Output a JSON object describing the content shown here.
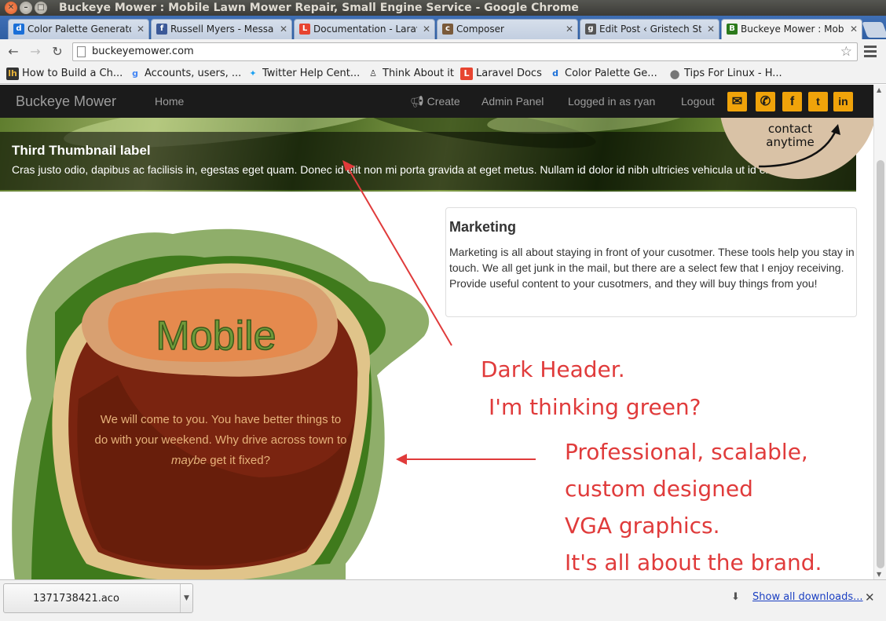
{
  "window": {
    "title": "Buckeye Mower : Mobile Lawn Mower Repair, Small Engine Service - Google Chrome"
  },
  "tabs": [
    {
      "label": "Color Palette Generato",
      "icon": "d-logo-icon",
      "color": "#1a6fd8"
    },
    {
      "label": "Russell Myers - Message",
      "icon": "facebook-icon",
      "color": "#3b5998"
    },
    {
      "label": "Documentation - Larave",
      "icon": "laravel-icon",
      "color": "#e74430"
    },
    {
      "label": "Composer",
      "icon": "composer-icon",
      "color": "#7a5a3a"
    },
    {
      "label": "Edit Post ‹ Gristech Stu",
      "icon": "gristech-icon",
      "color": "#555555"
    },
    {
      "label": "Buckeye Mower : Mobil",
      "icon": "buckeye-b-icon",
      "color": "#2c7a1c"
    }
  ],
  "toolbar": {
    "url": "buckeyemower.com"
  },
  "bookmarks": [
    {
      "label": "How to Build a Ch...",
      "icon": "lh-icon"
    },
    {
      "label": "Accounts, users, ...",
      "icon": "google-icon"
    },
    {
      "label": "Twitter Help Cent...",
      "icon": "twitter-bird-icon"
    },
    {
      "label": "Think About it",
      "icon": "figure-icon"
    },
    {
      "label": "Laravel Docs",
      "icon": "laravel-icon"
    },
    {
      "label": "Color Palette Ge...",
      "icon": "d-logo-icon"
    },
    {
      "label": "Tips For Linux - H...",
      "icon": "circle-icon"
    }
  ],
  "site": {
    "brand": "Buckeye Mower",
    "nav": {
      "home": "Home",
      "create": "Create",
      "admin": "Admin Panel",
      "logged": "Logged in as ryan",
      "logout": "Logout"
    },
    "accent": "#f0a30a",
    "hero": {
      "title": "Third Thumbnail label",
      "text": "Cras justo odio, dapibus ac facilisis in, egestas eget quam. Donec id elit non mi porta gravida at eget metus. Nullam id dolor id nibh ultricies vehicula ut id elit.",
      "contact_line1": "contact",
      "contact_line2": "anytime"
    },
    "marketing": {
      "title": "Marketing",
      "text": "Marketing is all about staying in front of your cusotmer. These tools help you stay in touch. We all get junk in the mail, but there are a select few that I enjoy receiving. Provide useful content to your cusotmers, and they will buy things from you!"
    },
    "mobile": {
      "title": "Mobile",
      "text_before": "We will come to you. You have better things to do with your weekend. Why drive across town to ",
      "text_em": "maybe",
      "text_after": " get it fixed?"
    }
  },
  "annotations": {
    "dark1": "Dark Header.",
    "dark2": "I'm thinking green?",
    "pro1": "Professional, scalable,",
    "pro2": "custom designed",
    "pro3": "VGA graphics.",
    "pro4": "It's all about the brand."
  },
  "downloads": {
    "file": "1371738421.aco",
    "show_all": "Show all downloads..."
  }
}
